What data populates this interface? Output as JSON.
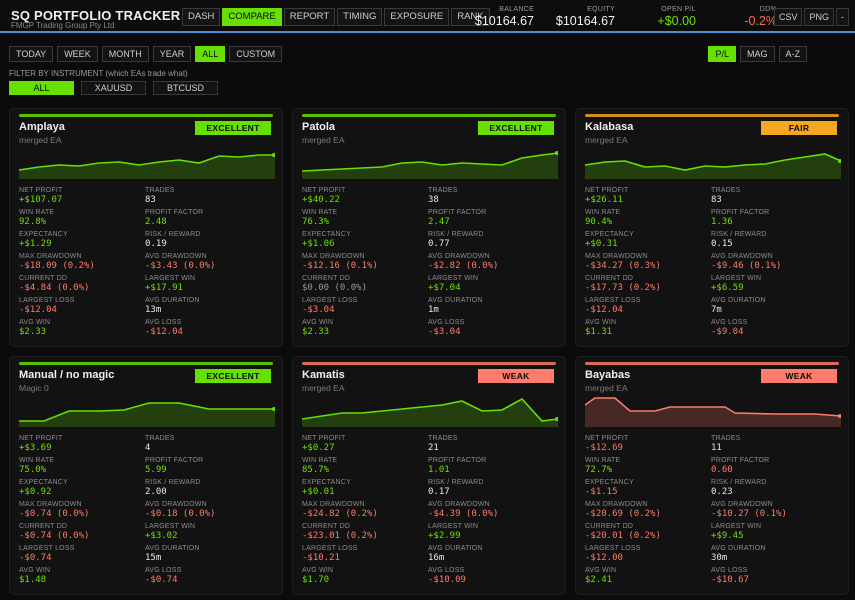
{
  "brand": {
    "title": "SQ  PORTFOLIO TRACKER",
    "subtitle": "FMGP Trading Group Pty Ltd"
  },
  "nav": [
    "DASH",
    "COMPARE",
    "REPORT",
    "TIMING",
    "EXPOSURE",
    "RANK"
  ],
  "nav_active": "COMPARE",
  "stats": {
    "balance_label": "BALANCE",
    "balance": "$10164.67",
    "equity_label": "EQUITY",
    "equity": "$10164.67",
    "openpl_label": "OPEN P/L",
    "openpl": "+$0.00",
    "dd_label": "DD%",
    "dd": "-0.2%"
  },
  "tools": [
    "CSV",
    "PNG",
    "-"
  ],
  "periods": [
    "TODAY",
    "WEEK",
    "MONTH",
    "YEAR",
    "ALL",
    "CUSTOM"
  ],
  "period_active": "ALL",
  "sort": [
    "P/L",
    "MAG",
    "A-Z"
  ],
  "sort_active": "P/L",
  "filter_label": "FILTER BY INSTRUMENT  (which EAs trade what)",
  "filters": [
    "ALL",
    "XAUUSD",
    "BTCUSD"
  ],
  "filter_active": "ALL",
  "colors": {
    "accent": "#66e000",
    "excellent": "#66e000",
    "fair": "#f5a623",
    "weak": "#ff7b6b",
    "neg": "#ff7a66",
    "link": "#4a8ed8"
  },
  "metric_labels": [
    "NET PROFIT",
    "TRADES",
    "WIN RATE",
    "PROFIT FACTOR",
    "EXPECTANCY",
    "RISK / REWARD",
    "MAX DRAWDOWN",
    "AVG DRAWDOWN",
    "CURRENT DD",
    "LARGEST WIN",
    "LARGEST LOSS",
    "AVG DURATION",
    "AVG WIN",
    "AVG LOSS"
  ],
  "cards": [
    {
      "name": "Amplaya",
      "sub": "merged EA",
      "rating": "EXCELLENT",
      "rating_color": "#66e000",
      "values": [
        "+$107.07",
        "83",
        "92.8%",
        "2.48",
        "+$1.29",
        "0.19",
        "-$18.09 (0.2%)",
        "-$3.43 (0.0%)",
        "-$4.84 (0.0%)",
        "+$17.91",
        "-$12.04",
        "13m",
        "$2.33",
        "-$12.04"
      ],
      "tones": [
        "pos",
        "neu",
        "pos",
        "pos",
        "pos",
        "neu",
        "neg",
        "neg",
        "neg",
        "pos",
        "neg",
        "neu",
        "pos",
        "neg"
      ]
    },
    {
      "name": "Patola",
      "sub": "merged EA",
      "rating": "EXCELLENT",
      "rating_color": "#66e000",
      "values": [
        "+$40.22",
        "38",
        "76.3%",
        "2.47",
        "+$1.06",
        "0.77",
        "-$12.16 (0.1%)",
        "-$2.82 (0.0%)",
        "$0.00 (0.0%)",
        "+$7.04",
        "-$3.04",
        "1m",
        "$2.33",
        "-$3.04"
      ],
      "tones": [
        "pos",
        "neu",
        "pos",
        "pos",
        "pos",
        "neu",
        "neg",
        "neg",
        "muted",
        "pos",
        "neg",
        "neu",
        "pos",
        "neg"
      ]
    },
    {
      "name": "Kalabasa",
      "sub": "merged EA",
      "rating": "FAIR",
      "rating_color": "#f5a623",
      "values": [
        "+$26.11",
        "83",
        "90.4%",
        "1.36",
        "+$0.31",
        "0.15",
        "-$34.27 (0.3%)",
        "-$9.46 (0.1%)",
        "-$17.73 (0.2%)",
        "+$6.59",
        "-$12.04",
        "7m",
        "$1.31",
        "-$9.04"
      ],
      "tones": [
        "pos",
        "neu",
        "pos",
        "pos",
        "pos",
        "neu",
        "neg",
        "neg",
        "neg",
        "pos",
        "neg",
        "neu",
        "pos",
        "neg"
      ]
    },
    {
      "name": "Manual / no magic",
      "sub": "Magic 0",
      "rating": "EXCELLENT",
      "rating_color": "#66e000",
      "values": [
        "+$3.69",
        "4",
        "75.0%",
        "5.99",
        "+$0.92",
        "2.00",
        "-$0.74 (0.0%)",
        "-$0.18 (0.0%)",
        "-$0.74 (0.0%)",
        "+$3.02",
        "-$0.74",
        "15m",
        "$1.48",
        "-$0.74"
      ],
      "tones": [
        "pos",
        "neu",
        "pos",
        "pos",
        "pos",
        "neu",
        "neg",
        "neg",
        "neg",
        "pos",
        "neg",
        "neu",
        "pos",
        "neg"
      ]
    },
    {
      "name": "Kamatis",
      "sub": "merged EA",
      "rating": "WEAK",
      "rating_color": "#ff7b6b",
      "values": [
        "+$0.27",
        "21",
        "85.7%",
        "1.01",
        "+$0.01",
        "0.17",
        "-$24.82 (0.2%)",
        "-$4.39 (0.0%)",
        "-$23.01 (0.2%)",
        "+$2.99",
        "-$10.21",
        "16m",
        "$1.70",
        "-$10.09"
      ],
      "tones": [
        "pos",
        "neu",
        "pos",
        "pos",
        "pos",
        "neu",
        "neg",
        "neg",
        "neg",
        "pos",
        "neg",
        "neu",
        "pos",
        "neg"
      ]
    },
    {
      "name": "Bayabas",
      "sub": "merged EA",
      "rating": "WEAK",
      "rating_color": "#ff7b6b",
      "values": [
        "-$12.69",
        "11",
        "72.7%",
        "0.60",
        "-$1.15",
        "0.23",
        "-$20.69 (0.2%)",
        "-$10.27 (0.1%)",
        "-$20.01 (0.2%)",
        "+$9.45",
        "-$12.00",
        "30m",
        "$2.41",
        "-$10.67"
      ],
      "tones": [
        "neg",
        "neu",
        "pos",
        "neg",
        "neg",
        "neu",
        "neg",
        "neg",
        "neg",
        "pos",
        "neg",
        "neu",
        "pos",
        "neg"
      ]
    }
  ]
}
